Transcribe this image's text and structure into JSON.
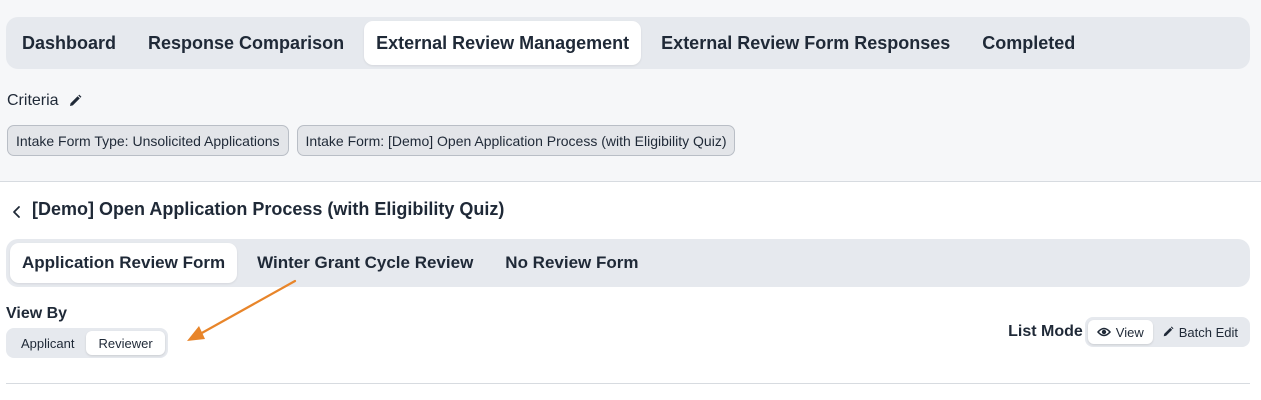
{
  "top_tabs": [
    {
      "label": "Dashboard",
      "active": false
    },
    {
      "label": "Response Comparison",
      "active": false
    },
    {
      "label": "External Review Management",
      "active": true
    },
    {
      "label": "External Review Form Responses",
      "active": false
    },
    {
      "label": "Completed",
      "active": false
    }
  ],
  "criteria": {
    "label": "Criteria",
    "edit_icon": "pencil-icon",
    "chips": [
      "Intake Form Type: Unsolicited Applications",
      "Intake Form: [Demo] Open Application Process (with Eligibility Quiz)"
    ]
  },
  "process": {
    "back_icon": "chevron-left-icon",
    "title": "[Demo] Open Application Process (with Eligibility Quiz)"
  },
  "review_tabs": [
    {
      "label": "Application Review Form",
      "active": true
    },
    {
      "label": "Winter Grant Cycle Review",
      "active": false
    },
    {
      "label": "No Review Form",
      "active": false
    }
  ],
  "view_by": {
    "label": "View By",
    "options": [
      {
        "label": "Applicant",
        "active": false
      },
      {
        "label": "Reviewer",
        "active": true
      }
    ]
  },
  "list_mode": {
    "label": "List Mode",
    "options": [
      {
        "label": "View",
        "icon": "eye-icon",
        "active": true
      },
      {
        "label": "Batch Edit",
        "icon": "pencil-icon",
        "active": false
      }
    ]
  },
  "annotation": {
    "color": "#e8852a"
  }
}
